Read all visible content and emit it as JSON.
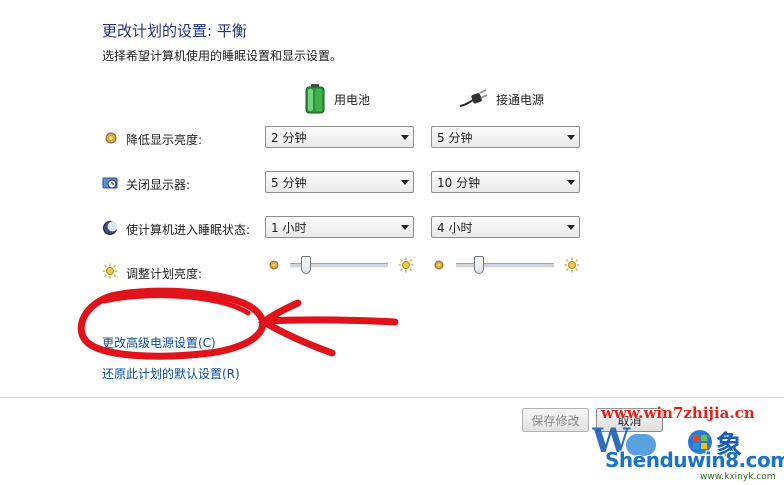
{
  "header": {
    "title": "更改计划的设置: 平衡",
    "subtitle": "选择希望计算机使用的睡眠设置和显示设置。"
  },
  "columns": {
    "battery_label": "用电池",
    "plugged_label": "接通电源"
  },
  "rows": [
    {
      "icon": "dim-display-icon",
      "label": "降低显示亮度:",
      "battery": "2 分钟",
      "plugged": "5 分钟"
    },
    {
      "icon": "monitor-clock-icon",
      "label": "关闭显示器:",
      "battery": "5 分钟",
      "plugged": "10 分钟"
    },
    {
      "icon": "moon-sleep-icon",
      "label": "使计算机进入睡眠状态:",
      "battery": "1 小时",
      "plugged": "4 小时"
    }
  ],
  "brightness": {
    "label": "调整计划亮度:",
    "battery_level": 0.12,
    "plugged_level": 0.2
  },
  "links": {
    "advanced": "更改高级电源设置(C)",
    "restore": "还原此计划的默认设置(R)"
  },
  "buttons": {
    "save": "保存修改",
    "cancel": "取消"
  },
  "watermark": {
    "url": "www.win7zhijia.cn",
    "brand": "Shenduwin8.com",
    "site": "www.kxinyk.com"
  },
  "colors": {
    "title": "#1e3287",
    "link": "#0a4b9b",
    "annotation": "#e0121a",
    "battery_green": "#3bb54a"
  }
}
